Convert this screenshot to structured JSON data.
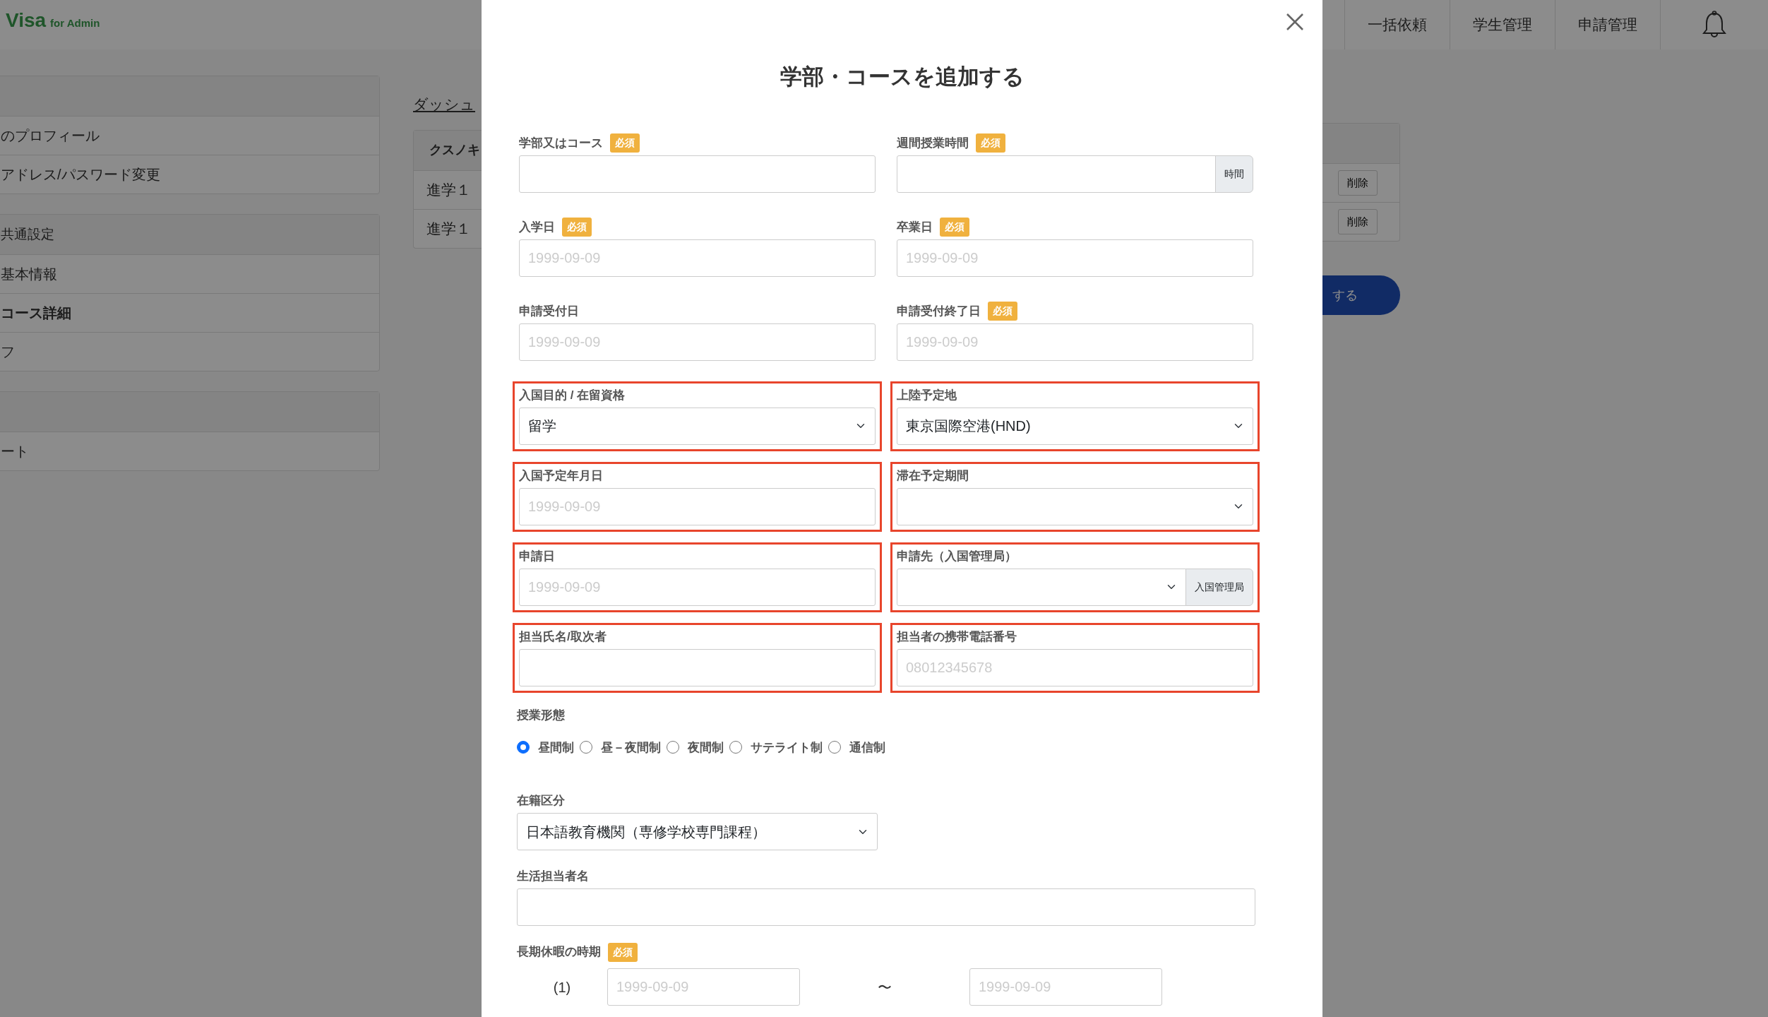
{
  "header": {
    "logo": "Visa",
    "logo_sub": "for Admin",
    "nav": [
      "一括依頼",
      "学生管理",
      "申請管理"
    ]
  },
  "sidebar": {
    "groups": [
      {
        "items": [
          {
            "label": "のプロフィール",
            "selected": false
          },
          {
            "label": "アドレス/パスワード変更",
            "selected": false
          }
        ]
      },
      {
        "title": "共通設定",
        "items": [
          {
            "label": "基本情報",
            "selected": false
          },
          {
            "label": "コース詳細",
            "selected": true
          },
          {
            "label": "フ",
            "selected": false
          }
        ]
      },
      {
        "items": [
          {
            "label": "ート",
            "selected": false
          }
        ]
      }
    ]
  },
  "breadcrumb": "ダッシュ",
  "table": {
    "header": "クスノキ",
    "rows": [
      {
        "cell": "進学１",
        "action": "削除"
      },
      {
        "cell": "進学１",
        "action": "削除"
      }
    ]
  },
  "add_button": "する",
  "modal": {
    "title": "学部・コースを追加する",
    "fields": [
      {
        "label": "学部又はコース",
        "badge": "必須",
        "kind": "text",
        "highlighted": false
      },
      {
        "label": "週間授業時間",
        "badge": "必須",
        "kind": "addon",
        "addon": "時間",
        "highlighted": false
      },
      {
        "label": "入学日",
        "badge": "必須",
        "kind": "date",
        "placeholder": "1999-09-09",
        "highlighted": false
      },
      {
        "label": "卒業日",
        "badge": "必須",
        "kind": "date",
        "placeholder": "1999-09-09",
        "highlighted": false
      },
      {
        "label": "申請受付日",
        "kind": "date",
        "placeholder": "1999-09-09",
        "highlighted": false
      },
      {
        "label": "申請受付終了日",
        "badge": "必須",
        "kind": "date",
        "placeholder": "1999-09-09",
        "highlighted": false
      },
      {
        "label": "入国目的 / 在留資格",
        "kind": "select",
        "value": "留学",
        "highlighted": true
      },
      {
        "label": "上陸予定地",
        "kind": "select",
        "value": "東京国際空港(HND)",
        "highlighted": true
      },
      {
        "label": "入国予定年月日",
        "kind": "date",
        "placeholder": "1999-09-09",
        "highlighted": true
      },
      {
        "label": "滞在予定期間",
        "kind": "select",
        "highlighted": true
      },
      {
        "label": "申請日",
        "kind": "date",
        "placeholder": "1999-09-09",
        "highlighted": true
      },
      {
        "label": "申請先（入国管理局）",
        "kind": "select_addon",
        "addon": "入国管理局",
        "highlighted": true
      },
      {
        "label": "担当氏名/取次者",
        "kind": "text",
        "highlighted": true
      },
      {
        "label": "担当者の携帯電話番号",
        "kind": "text",
        "placeholder": "08012345678",
        "highlighted": true
      }
    ],
    "lesson_type": {
      "label": "授業形態",
      "options": [
        {
          "label": "昼間制",
          "selected": true
        },
        {
          "label": "昼－夜間制",
          "selected": false
        },
        {
          "label": "夜間制",
          "selected": false
        },
        {
          "label": "サテライト制",
          "selected": false
        },
        {
          "label": "通信制",
          "selected": false
        }
      ]
    },
    "enrollment": {
      "label": "在籍区分",
      "value": "日本語教育機関（専修学校専門課程）"
    },
    "life_contact": {
      "label": "生活担当者名"
    },
    "vacation": {
      "label": "長期休暇の時期",
      "badge": "必須",
      "periods": [
        {
          "index": "(1)",
          "from_placeholder": "1999-09-09",
          "separator": "〜",
          "to_placeholder": "1999-09-09"
        }
      ]
    }
  }
}
